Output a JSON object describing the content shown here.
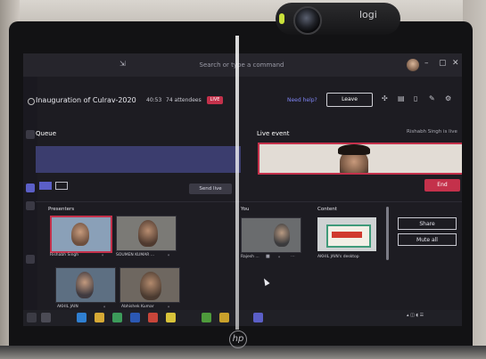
{
  "camera": {
    "brand": "logi"
  },
  "laptop": {
    "brand_logo": "hp"
  },
  "app": {
    "search_placeholder": "Search or type a command",
    "meeting_title": "Inauguration of Culrav-2020",
    "timer": "40:53",
    "attendees": "74 attendees",
    "live_badge": "LIVE",
    "help_link": "Need help?",
    "leave_button": "Leave",
    "live_status": "Rishabh Singh is live"
  },
  "queue": {
    "label": "Queue",
    "send_live_button": "Send live"
  },
  "live_event": {
    "label": "Live event",
    "end_button": "End"
  },
  "presenters": {
    "label": "Presenters",
    "items": [
      {
        "name": "Rishabh Singh"
      },
      {
        "name": "SOUMEN KUMAR ..."
      },
      {
        "name": "AKHIL JAIN"
      },
      {
        "name": "Abhishek Kumar"
      }
    ]
  },
  "you": {
    "label": "You",
    "name": "Rajesh ..."
  },
  "content": {
    "label": "Content",
    "source": "AKHIL JAIN's desktop"
  },
  "side_actions": {
    "share_button": "Share",
    "mute_all_button": "Mute all"
  },
  "accent_colors": {
    "live_red": "#c4314b",
    "teams_purple": "#5b5fc7"
  }
}
